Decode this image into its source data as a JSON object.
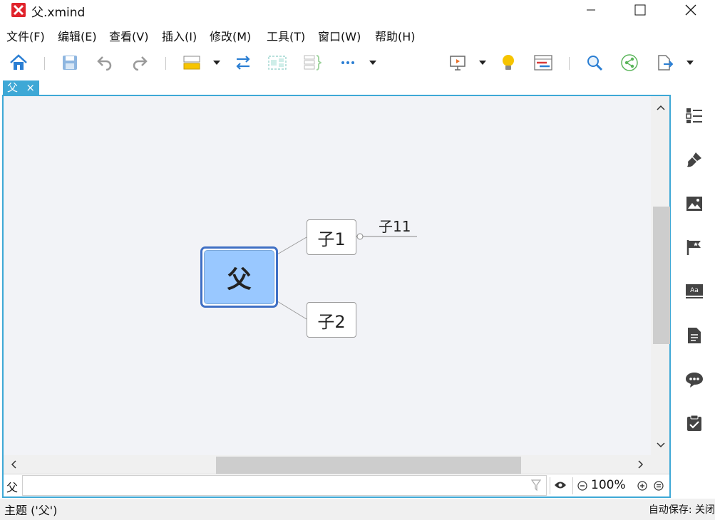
{
  "window": {
    "title": "父.xmind",
    "controls": [
      "minimize",
      "maximize",
      "close"
    ]
  },
  "menu": [
    "文件(F)",
    "编辑(E)",
    "查看(V)",
    "插入(I)",
    "修改(M)",
    "工具(T)",
    "窗口(W)",
    "帮助(H)"
  ],
  "toolbar_icons": [
    "home-icon",
    "save-icon",
    "undo-icon",
    "redo-icon",
    "topic-icon",
    "relationship-icon",
    "boundary-icon",
    "summary-icon",
    "more-icon",
    "presentation-icon",
    "idea-icon",
    "gantt-icon",
    "search-icon",
    "share-icon",
    "export-icon"
  ],
  "tab": {
    "label": "父",
    "close": "×"
  },
  "map": {
    "central": "父",
    "children": [
      {
        "label": "子1",
        "children": [
          "子11"
        ]
      },
      {
        "label": "子2"
      }
    ]
  },
  "filter": {
    "label": "父",
    "zoom": "100%"
  },
  "right_panel_icons": [
    "outline-icon",
    "format-icon",
    "image-icon",
    "marker-icon",
    "style-icon",
    "notes-icon",
    "comments-icon",
    "task-icon"
  ],
  "status": {
    "left": "主题 ('父')",
    "right": "自动保存: 关闭"
  },
  "colors": {
    "accent": "#3ea8d6",
    "central_fill": "#99c8ff",
    "central_border": "#3f6fc4",
    "canvas_bg": "#f2f3f7"
  }
}
